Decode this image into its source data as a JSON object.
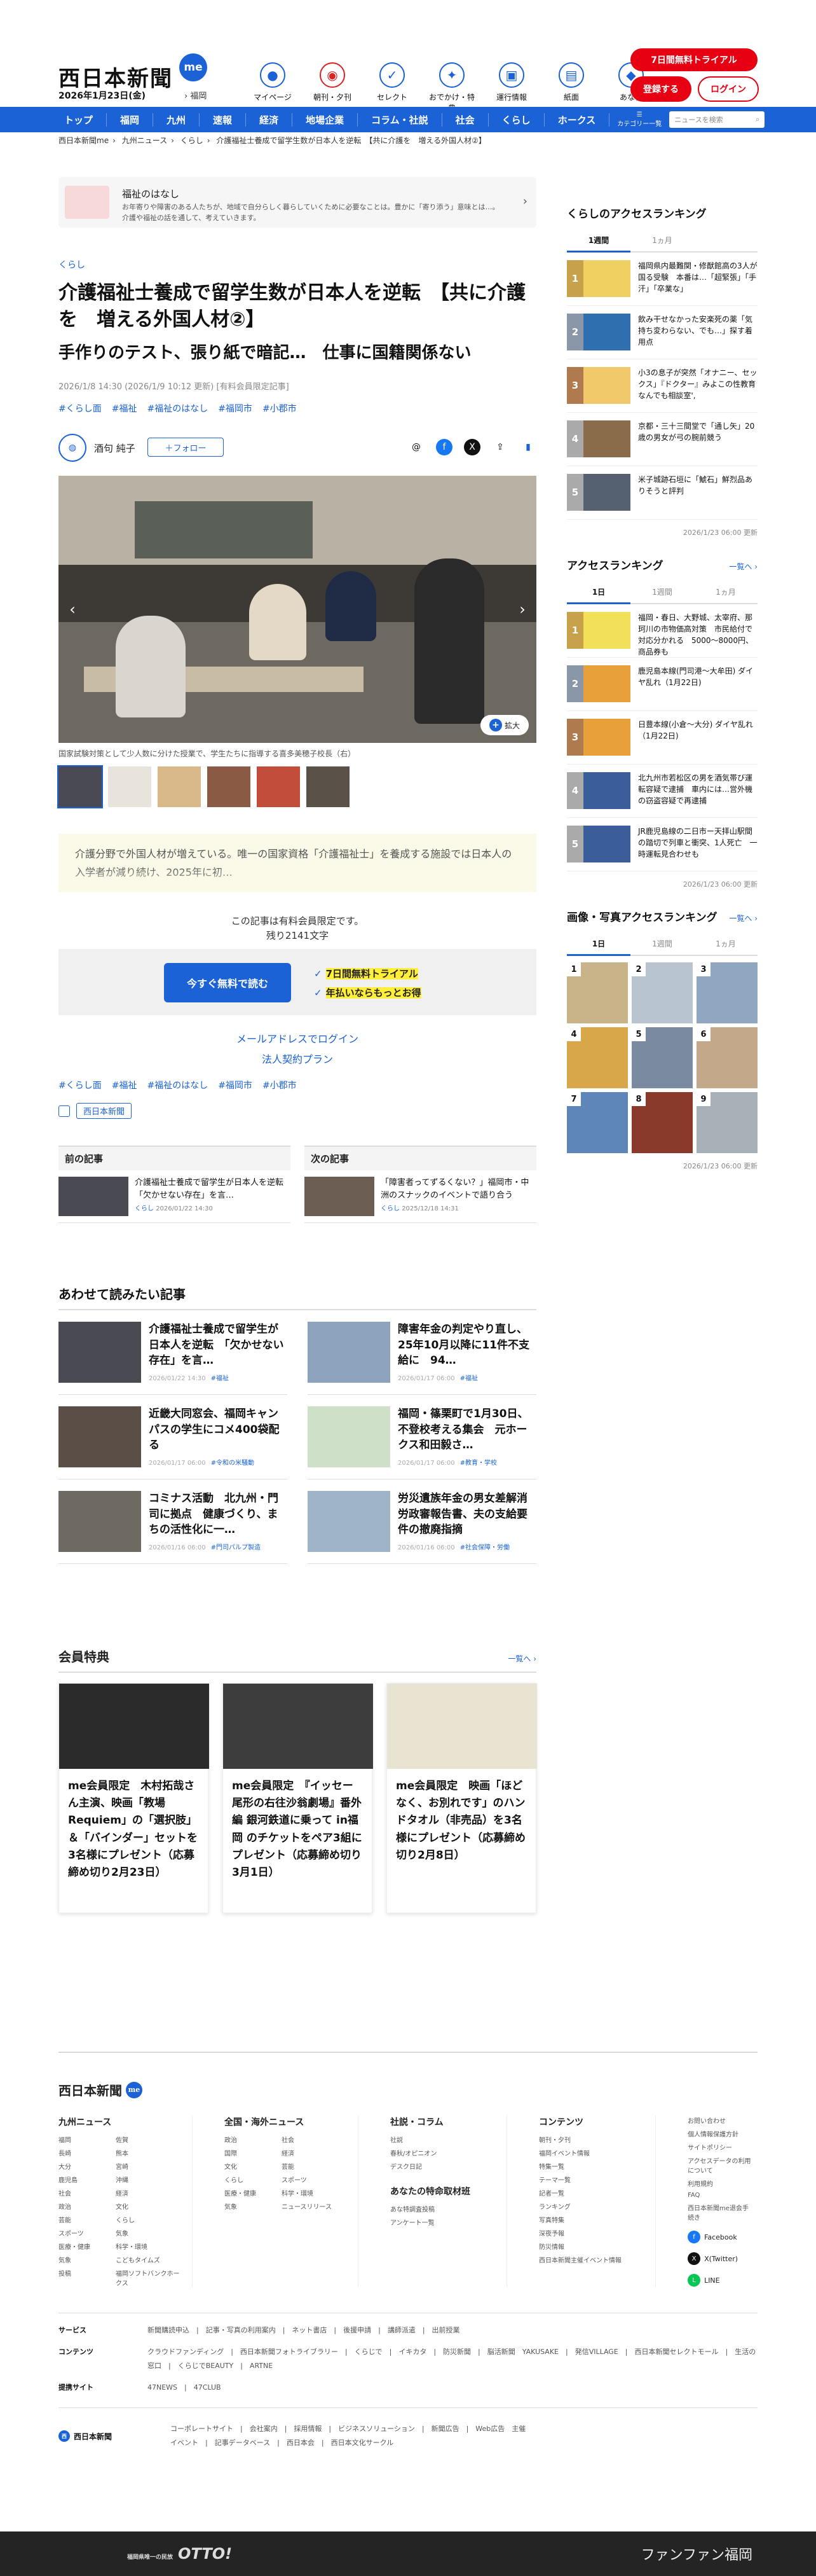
{
  "header": {
    "logo": "西日本新聞",
    "logo_badge": "me",
    "date": "2026年1月23日(金)",
    "location": "福岡",
    "icons": [
      {
        "label": "マイページ",
        "icon": "me-icon"
      },
      {
        "label": "朝刊・夕刊",
        "icon": "newspaper-icon"
      },
      {
        "label": "セレクト",
        "icon": "select-icon"
      },
      {
        "label": "おでかけ・特典",
        "icon": "outing-icon"
      },
      {
        "label": "運行情報",
        "icon": "train-icon"
      },
      {
        "label": "紙面",
        "icon": "paper-icon"
      },
      {
        "label": "あな特",
        "icon": "anatoku-icon"
      }
    ],
    "trial_label": "7日間無料トライアル",
    "register_label": "登録する",
    "login_label": "ログイン"
  },
  "nav": {
    "items": [
      "トップ",
      "福岡",
      "九州",
      "速報",
      "経済",
      "地場企業",
      "コラム・社説",
      "社会",
      "くらし",
      "ホークス"
    ],
    "category_label": "カテゴリー一覧",
    "search_placeholder": "ニュースを検索"
  },
  "breadcrumb": [
    "西日本新聞me",
    "九州ニュース",
    "くらし",
    "介護福祉士養成で留学生数が日本人を逆転　【共に介護を　増える外国人材②】"
  ],
  "banner": {
    "title": "福祉のはなし",
    "desc": "お年寄りや障害のある人たちが、地域で自分らしく暮らしていくために必要なことは。豊かに「寄り添う」意味とは…。介護や福祉の話を通して、考えていきます。"
  },
  "article": {
    "category": "くらし",
    "title": "介護福祉士養成で留学生数が日本人を逆転　【共に介護を　増える外国人材②】",
    "subtitle": "手作りのテスト、張り紙で暗記…　仕事に国籍関係ない",
    "date": "2026/1/8 14:30 (2026/1/9 10:12 更新) [有料会員限定記事]",
    "tags": [
      "#くらし面",
      "#福祉",
      "#福祉のはなし",
      "#福岡市",
      "#小郡市"
    ],
    "author": "酒句 純子",
    "follow_label": "フォロー",
    "zoom_label": "拡大",
    "caption": "国家試験対策として少人数に分けた授業で、学生たちに指導する喜多美穂子校長（右）",
    "lead": "介護分野で外国人材が増えている。唯一の国家資格「介護福祉士」を養成する施設では日本人の入学者が減り続け、2025年に初…",
    "paywall_line1": "この記事は有料会員限定です。",
    "paywall_line2": "残り2141文字",
    "read_free_label": "今すぐ無料で読む",
    "benefit1": "7日間無料トライアル",
    "benefit2": "年払いならもっとお得",
    "email_login": "メールアドレスでログイン",
    "corp_plan": "法人契約プラン",
    "tags2": [
      "#くらし面",
      "#福祉",
      "#福祉のはなし",
      "#福岡市",
      "#小郡市"
    ],
    "publisher": "西日本新聞"
  },
  "prevnext": {
    "prev_header": "前の記事",
    "prev_title": "介護福祉士養成で留学生が日本人を逆転　「欠かせない存在」を言…",
    "prev_cat": "くらし",
    "prev_date": "2026/01/22 14:30",
    "next_header": "次の記事",
    "next_title": "「障害者ってずるくない？」福岡市・中洲のスナックのイベントで語り合う",
    "next_cat": "くらし",
    "next_date": "2025/12/18 14:31"
  },
  "related": {
    "heading": "あわせて読みたい記事",
    "items": [
      {
        "title": "介護福祉士養成で留学生が日本人を逆転　「欠かせない存在」を言…",
        "date": "2026/01/22 14:30",
        "tag": "#福祉"
      },
      {
        "title": "障害年金の判定やり直し、25年10月以降に11件不支給に　94…",
        "date": "2026/01/17 06:00",
        "tag": "#福祉"
      },
      {
        "title": "近畿大同窓会、福岡キャンパスの学生にコメ400袋配る",
        "date": "2026/01/17 06:00",
        "tag": "#令和の米騒動"
      },
      {
        "title": "福岡・篠栗町で1月30日、不登校考える集会　元ホークス和田毅さ…",
        "date": "2026/01/17 06:00",
        "tag": "#教育・学校"
      },
      {
        "title": "コミナス活動　北九州・門司に拠点　健康づくり、まちの活性化に一…",
        "date": "2026/01/16 06:00",
        "tag": "#門司パルプ製造"
      },
      {
        "title": "労災遺族年金の男女差解消　労政審報告書、夫の支給要件の撤廃指摘",
        "date": "2026/01/16 06:00",
        "tag": "#社会保障・労働"
      }
    ]
  },
  "members": {
    "heading": "会員特典",
    "more": "一覧へ",
    "items": [
      "me会員限定　木村拓哉さん主演、映画「教場 Requiem」の「選択肢」＆「バインダー」セットを3名様にプレゼント（応募締め切り2月23日）",
      "me会員限定　『イッセー尾形の右往沙翁劇場』番外編 銀河鉄道に乗って in福岡 のチケットをペア3組にプレゼント（応募締め切り3月1日）",
      "me会員限定　映画「ほどなく、お別れです」のハンドタオル（非売品）を3名様にプレゼント（応募締め切り2月8日）"
    ]
  },
  "side": {
    "kurashi_rank": {
      "heading": "くらしのアクセスランキング",
      "tabs": [
        "1週間",
        "1ヵ月"
      ],
      "items": [
        "福岡県内最難関・修猷館高の3人が国る受験　本番は…「超緊張」「手汗」「卒業な」",
        "飲み干せなかった安楽死の薬「気持ち変わらない、でも…」探す着用点",
        "小3の息子が突然「オナニー、セックス」『ドクター』みよこの性教育なんでも相談室',",
        "京都・三十三間堂で「通し矢」20歳の男女が弓の腕前競う",
        "米子城跡石垣に「鯱石」鮮烈品ありそうと評判"
      ],
      "updated": "2026/1/23 06:00 更新"
    },
    "access_rank": {
      "heading": "アクセスランキング",
      "more": "一覧へ",
      "tabs": [
        "1日",
        "1週間",
        "1ヵ月"
      ],
      "items": [
        "福岡・春日、大野城、太宰府、那珂川の市物価高対策　市民給付で対応分かれる　5000〜8000円、商品券も",
        "鹿児島本線(門司港〜大牟田) ダイヤ乱れ（1月22日)",
        "日豊本線(小倉〜大分) ダイヤ乱れ（1月22日)",
        "北九州市若松区の男を酒気帯び運転容疑で逮捕　車内には…営外機の窃盗容疑で再逮捕",
        "JR鹿児島線の二日市ー天拝山駅間の踏切で列車と衝突、1人死亡　一時運転見合わせも"
      ],
      "updated": "2026/1/23 06:00 更新"
    },
    "image_rank": {
      "heading": "画像・写真アクセスランキング",
      "more": "一覧へ",
      "tabs": [
        "1日",
        "1週間",
        "1ヵ月"
      ],
      "numbers": [
        "1",
        "2",
        "3",
        "4",
        "5",
        "6",
        "7",
        "8",
        "9"
      ],
      "updated": "2026/1/23 06:00 更新"
    }
  },
  "footer": {
    "logo": "西日本新聞",
    "kyushu": {
      "heading": "九州ニュース",
      "items": [
        "福岡",
        "佐賀",
        "長崎",
        "熊本",
        "大分",
        "宮崎",
        "鹿児島",
        "沖縄",
        "社会",
        "経済",
        "政治",
        "文化",
        "芸能",
        "くらし",
        "スポーツ",
        "気象",
        "医療・健康",
        "科学・環境",
        "気象",
        "こどもタイムズ",
        "投稿",
        "福岡ソフトバンクホークス"
      ]
    },
    "national": {
      "heading": "全国・海外ニュース",
      "items": [
        "政治",
        "社会",
        "国際",
        "経済",
        "文化",
        "芸能",
        "くらし",
        "スポーツ",
        "医療・健康",
        "科学・環境",
        "気象",
        "ニュースリリース"
      ]
    },
    "opinion": {
      "heading": "社説・コラム",
      "items": [
        "社説",
        "春秋/オピニオン",
        "デスク日記"
      ],
      "anatoku_heading": "あなたの特命取材班",
      "anatoku_items": [
        "あな特調査投稿",
        "アンケート一覧"
      ]
    },
    "contents": {
      "heading": "コンテンツ",
      "items": [
        "朝刊・夕刊",
        "福岡イベント情報",
        "特集一覧",
        "テーマ一覧",
        "記者一覧",
        "ランキング",
        "写真特集",
        "深夜予報",
        "防災情報",
        "西日本新聞主催イベント情報"
      ]
    },
    "info": {
      "items": [
        "お問い合わせ",
        "個人情報保護方針",
        "サイトポリシー",
        "アクセスデータの利用について",
        "利用規約",
        "FAQ",
        "西日本新聞me退会手続き"
      ],
      "facebook": "Facebook",
      "x": "X(Twitter)",
      "line": "LINE"
    },
    "rows": [
      {
        "label": "サービス",
        "text": "新聞購読申込　|　記事・写真の利用案内　|　ネット書店　|　後援申請　|　講師派遣　|　出前授業"
      },
      {
        "label": "コンテンツ",
        "text": "クラウドファンディング　|　西日本新聞フォトライブラリー　|　くらじで　|　イキカタ　|　防災新聞　|　脳活新聞　YAKUSAKE　|　発信VILLAGE　|　西日本新聞セレクトモール　|　生活の窓口　|　くらじでBEAUTY　|　ARTNE"
      },
      {
        "label": "提携サイト",
        "text": "47NEWS　|　47CLUB"
      }
    ],
    "bottom_logo": "西日本新聞",
    "bottom_links": "コーポレートサイト　|　会社案内　|　採用情報　|　ビジネスソリューション　|　新聞広告　|　Web広告　主催イベント　|　記事データベース　|　西日本会　|　西日本文化サークル"
  },
  "bottom_ad": {
    "left_small": "福岡県唯一の民放",
    "left": "OTTO!",
    "right": "ファンファン福岡"
  }
}
